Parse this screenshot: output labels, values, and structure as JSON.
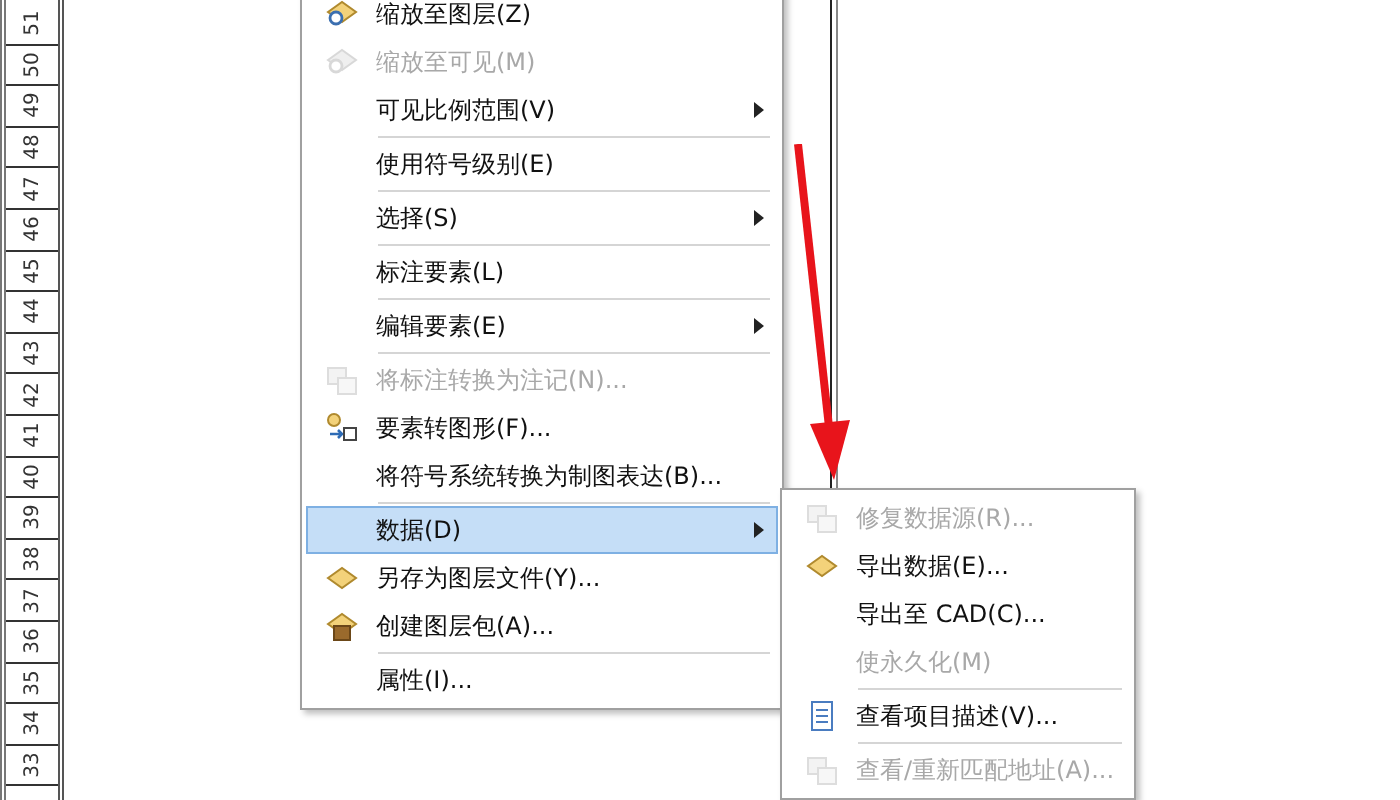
{
  "ruler": {
    "labels": [
      "51",
      "50",
      "49",
      "48",
      "47",
      "46",
      "45",
      "44",
      "43",
      "42",
      "41",
      "40",
      "39",
      "38",
      "37",
      "36",
      "35",
      "34",
      "33"
    ]
  },
  "context_menu": {
    "items": [
      {
        "kind": "item",
        "label": "缩放至图层(Z)",
        "disabled": false,
        "submenu": false,
        "selected": false
      },
      {
        "kind": "item",
        "label": "缩放至可见(M)",
        "disabled": true,
        "submenu": false,
        "selected": false
      },
      {
        "kind": "item",
        "label": "可见比例范围(V)",
        "disabled": false,
        "submenu": true,
        "selected": false
      },
      {
        "kind": "separator"
      },
      {
        "kind": "item",
        "label": "使用符号级别(E)",
        "disabled": false,
        "submenu": false,
        "selected": false
      },
      {
        "kind": "separator"
      },
      {
        "kind": "item",
        "label": "选择(S)",
        "disabled": false,
        "submenu": true,
        "selected": false
      },
      {
        "kind": "separator"
      },
      {
        "kind": "item",
        "label": "标注要素(L)",
        "disabled": false,
        "submenu": false,
        "selected": false
      },
      {
        "kind": "separator"
      },
      {
        "kind": "item",
        "label": "编辑要素(E)",
        "disabled": false,
        "submenu": true,
        "selected": false
      },
      {
        "kind": "separator"
      },
      {
        "kind": "item",
        "label": "将标注转换为注记(N)...",
        "disabled": true,
        "submenu": false,
        "selected": false
      },
      {
        "kind": "item",
        "label": "要素转图形(F)...",
        "disabled": false,
        "submenu": false,
        "selected": false
      },
      {
        "kind": "item",
        "label": "将符号系统转换为制图表达(B)...",
        "disabled": false,
        "submenu": false,
        "selected": false
      },
      {
        "kind": "separator"
      },
      {
        "kind": "item",
        "label": "数据(D)",
        "disabled": false,
        "submenu": true,
        "selected": true
      },
      {
        "kind": "item",
        "label": "另存为图层文件(Y)...",
        "disabled": false,
        "submenu": false,
        "selected": false
      },
      {
        "kind": "item",
        "label": "创建图层包(A)...",
        "disabled": false,
        "submenu": false,
        "selected": false
      },
      {
        "kind": "separator"
      },
      {
        "kind": "item",
        "label": "属性(I)...",
        "disabled": false,
        "submenu": false,
        "selected": false
      }
    ]
  },
  "submenu": {
    "items": [
      {
        "kind": "item",
        "label": "修复数据源(R)...",
        "disabled": true
      },
      {
        "kind": "item",
        "label": "导出数据(E)...",
        "disabled": false
      },
      {
        "kind": "item",
        "label": "导出至 CAD(C)...",
        "disabled": false
      },
      {
        "kind": "item",
        "label": "使永久化(M)",
        "disabled": true
      },
      {
        "kind": "separator"
      },
      {
        "kind": "item",
        "label": "查看项目描述(V)...",
        "disabled": false
      },
      {
        "kind": "separator"
      },
      {
        "kind": "item",
        "label": "查看/重新匹配地址(A)...",
        "disabled": true
      }
    ]
  }
}
